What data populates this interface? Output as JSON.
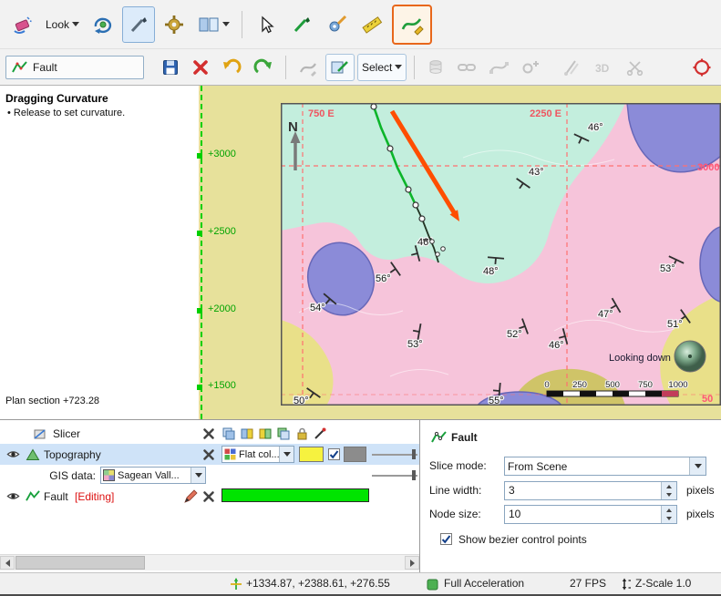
{
  "toolbars": {
    "top": {
      "look": "Look"
    },
    "edit": {
      "object_label": "Fault",
      "select": "Select",
      "icon_3d": "3D"
    }
  },
  "scene": {
    "overlay": {
      "title": "Dragging Curvature",
      "hint": "• Release to set curvature."
    },
    "plan_label": "Plan section +723.28",
    "north": "N",
    "axis_labels": [
      "+3000",
      "+2500",
      "+2000",
      "+1500"
    ],
    "grid": {
      "east_a": "750 E",
      "east_b": "2250 E",
      "right": "3000",
      "bottom_right": "50"
    },
    "dips": [
      "46°",
      "43°",
      "46°",
      "48°",
      "56°",
      "54°",
      "53°",
      "52°",
      "46°",
      "47°",
      "53°",
      "51°",
      "55°",
      "50°"
    ],
    "looking_down": "Looking down",
    "scale_ticks": [
      "0",
      "250",
      "500",
      "750",
      "1000"
    ]
  },
  "layers": {
    "slicer": {
      "label": "Slicer"
    },
    "topography": {
      "label": "Topography",
      "style": "Flat col...",
      "gis_label": "GIS data:",
      "gis_value": "Sagean Vall..."
    },
    "fault": {
      "label": "Fault",
      "status": "[Editing]"
    }
  },
  "properties": {
    "title": "Fault",
    "slice_mode": {
      "label": "Slice mode:",
      "value": "From Scene"
    },
    "line_width": {
      "label": "Line width:",
      "value": "3",
      "unit": "pixels"
    },
    "node_size": {
      "label": "Node size:",
      "value": "10",
      "unit": "pixels"
    },
    "bezier_label": "Show bezier control points",
    "bezier_checked": true
  },
  "status": {
    "coords": "+1334.87, +2388.61, +276.55",
    "accel": "Full Acceleration",
    "fps": "27 FPS",
    "zscale": "Z-Scale 1.0"
  },
  "colors": {
    "highlight_orange": "#e8671b",
    "section_green": "#00cf00",
    "editing_red": "#dd1111",
    "fault_bar_green": "#00e400"
  }
}
